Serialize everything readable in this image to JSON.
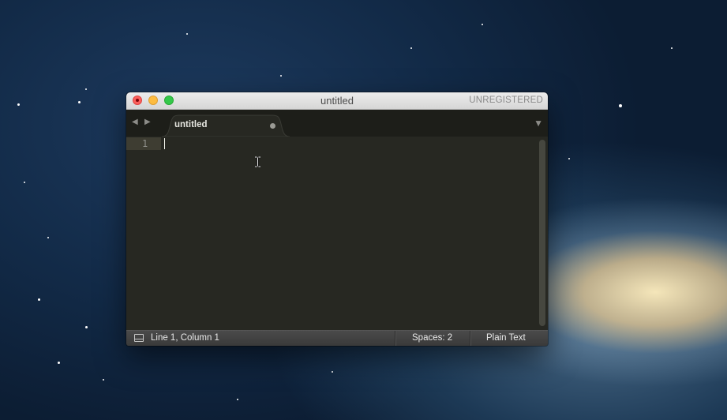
{
  "window": {
    "title": "untitled",
    "license_status": "UNREGISTERED"
  },
  "tabs": [
    {
      "label": "untitled",
      "modified": true
    }
  ],
  "editor": {
    "line_numbers": [
      "1"
    ],
    "current_line": 1,
    "content": ""
  },
  "statusbar": {
    "position": "Line 1, Column 1",
    "indentation": "Spaces: 2",
    "syntax": "Plain Text"
  },
  "icons": {
    "nav_back": "◀",
    "nav_forward": "▶",
    "tab_menu": "▼"
  },
  "colors": {
    "editor_background": "#272822",
    "tabbar_background": "#1d1e19",
    "close_button": "#fc605c",
    "minimize_button": "#fdbc40",
    "maximize_button": "#34c84a"
  }
}
